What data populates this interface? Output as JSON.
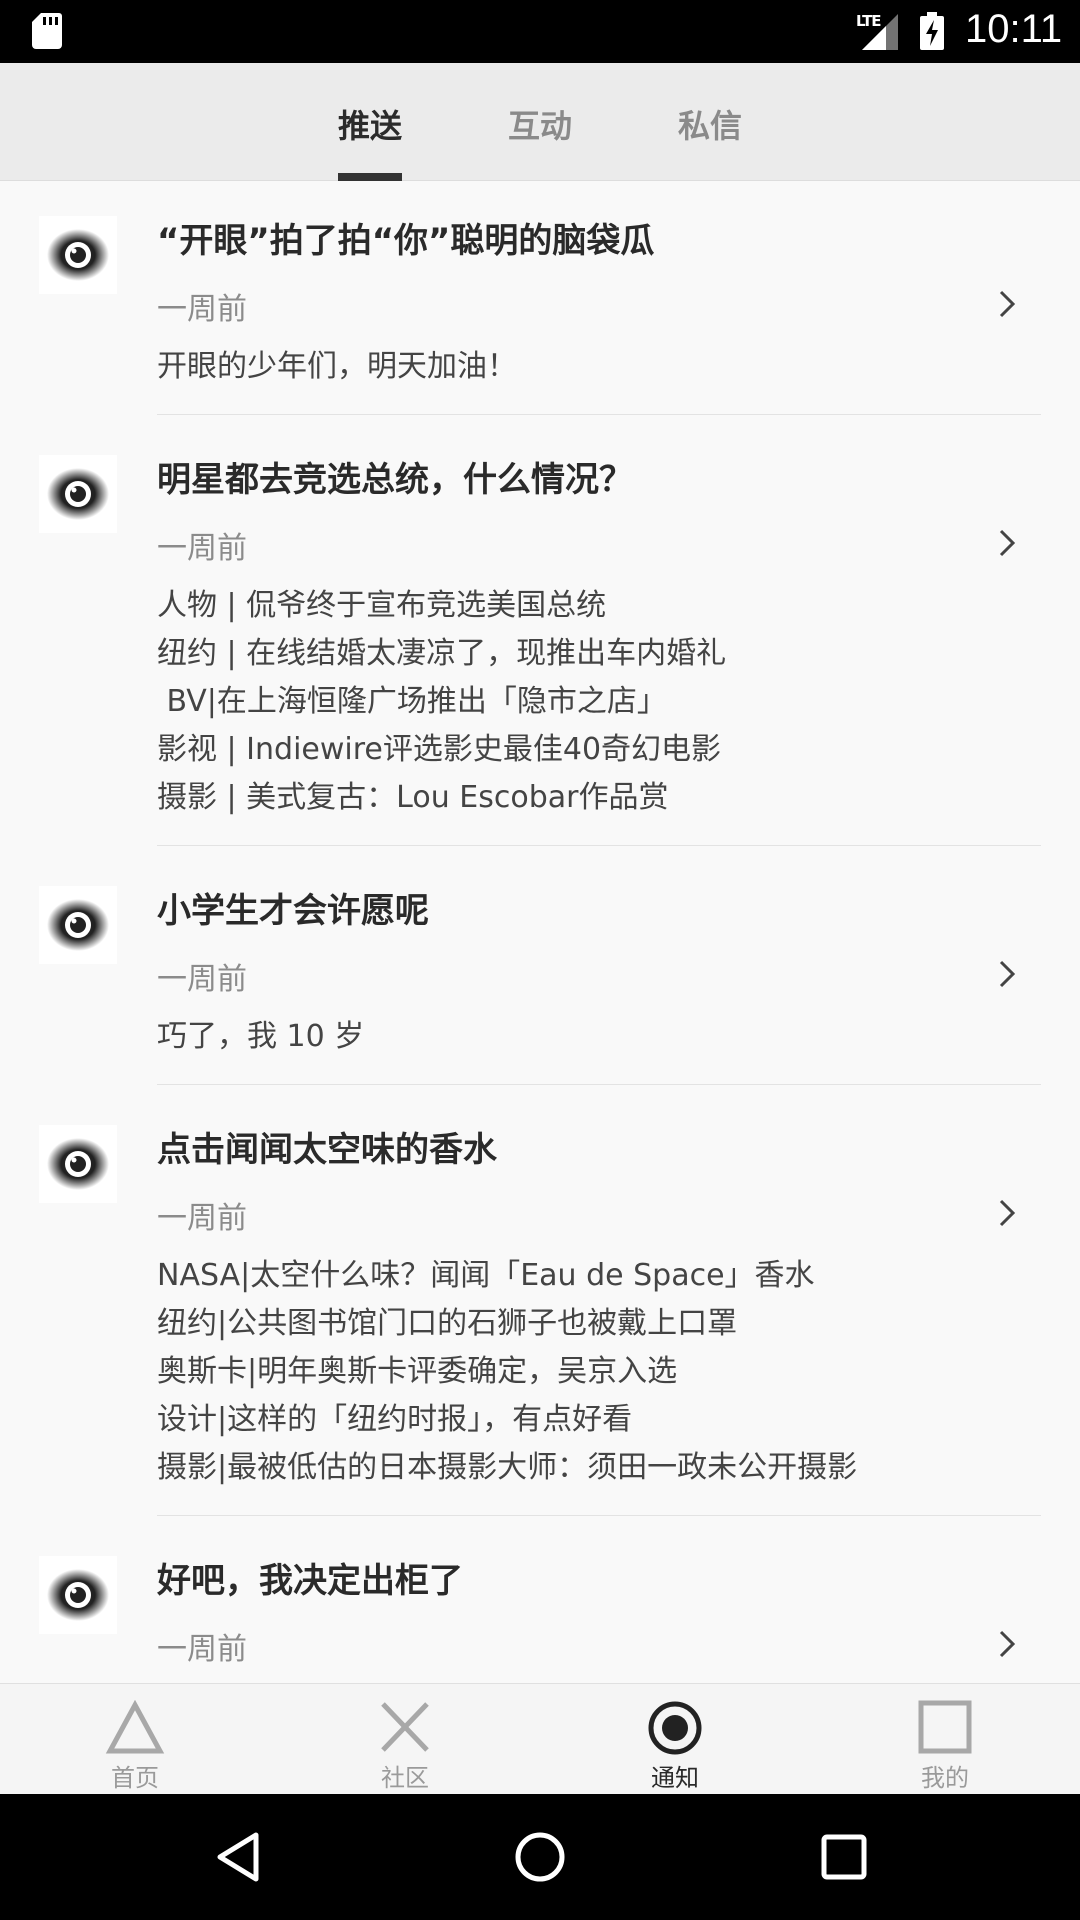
{
  "status_bar": {
    "time": "10:11",
    "network": "LTE"
  },
  "tabs": [
    {
      "label": "推送",
      "active": true
    },
    {
      "label": "互动",
      "active": false
    },
    {
      "label": "私信",
      "active": false
    }
  ],
  "items": [
    {
      "title": "“开眼”拍了拍“你”聪明的脑袋瓜",
      "time": "一周前",
      "lines": [
        "开眼的少年们，明天加油！"
      ]
    },
    {
      "title": "明星都去竞选总统，什么情况？",
      "time": "一周前",
      "lines": [
        "人物 | 侃爷终于宣布竞选美国总统",
        "纽约 | 在线结婚太凄凉了，现推出车内婚礼",
        " BV|在上海恒隆广场推出「隐市之店」",
        "影视 | Indiewire评选影史最佳40奇幻电影",
        "摄影 | 美式复古：Lou Escobar作品赏"
      ]
    },
    {
      "title": "小学生才会许愿呢",
      "time": "一周前",
      "lines": [
        "巧了，我 10 岁"
      ]
    },
    {
      "title": "点击闻闻太空味的香水",
      "time": "一周前",
      "lines": [
        "NASA|太空什么味？闻闻「Eau de Space」香水",
        "纽约|公共图书馆门口的石狮子也被戴上口罩",
        "奥斯卡|明年奥斯卡评委确定，吴京入选",
        "设计|这样的「纽约时报」，有点好看",
        "摄影|最被低估的日本摄影大师：须田一政未公开摄影"
      ]
    },
    {
      "title": "好吧，我决定出柜了",
      "time": "一周前",
      "lines": []
    }
  ],
  "bottom_nav": [
    {
      "label": "首页",
      "icon": "triangle-icon",
      "active": false
    },
    {
      "label": "社区",
      "icon": "cross-icon",
      "active": false
    },
    {
      "label": "通知",
      "icon": "circle-target-icon",
      "active": true
    },
    {
      "label": "我的",
      "icon": "square-icon",
      "active": false
    }
  ],
  "colors": {
    "accent": "#333333",
    "inactive": "#9a9a9a",
    "background": "#f9f9f9"
  }
}
